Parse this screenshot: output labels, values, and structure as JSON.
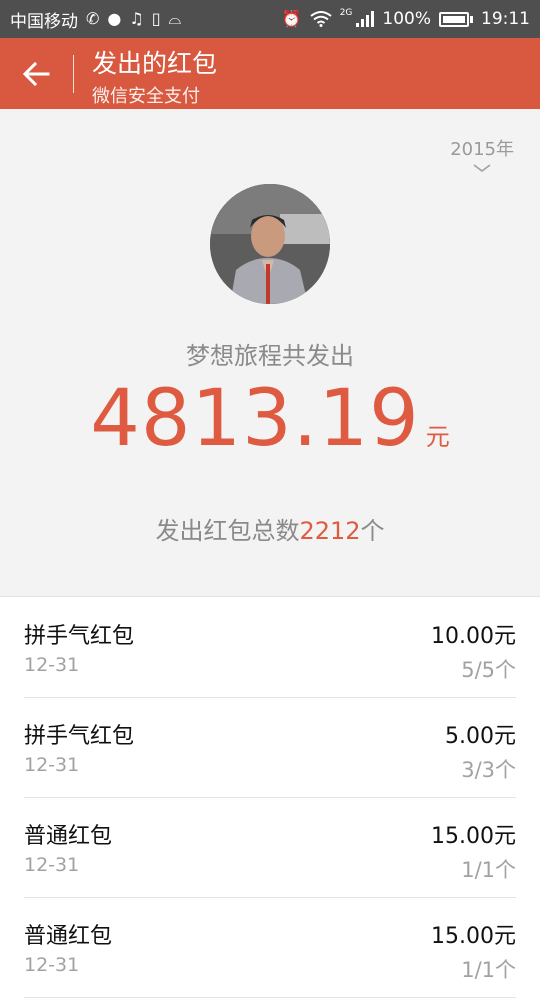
{
  "status_bar": {
    "carrier": "中国移动",
    "battery": "100%",
    "network": "2G",
    "time": "19:11"
  },
  "header": {
    "title": "发出的红包",
    "subtitle": "微信安全支付"
  },
  "summary": {
    "year": "2015年",
    "sender_line": "梦想旅程共发出",
    "amount": "4813.19",
    "amount_unit": "元",
    "count_prefix": "发出红包总数",
    "count": "2212",
    "count_suffix": "个"
  },
  "records": [
    {
      "name": "拼手气红包",
      "date": "12-31",
      "amount": "10.00元",
      "count": "5/5个"
    },
    {
      "name": "拼手气红包",
      "date": "12-31",
      "amount": "5.00元",
      "count": "3/3个"
    },
    {
      "name": "普通红包",
      "date": "12-31",
      "amount": "15.00元",
      "count": "1/1个"
    },
    {
      "name": "普通红包",
      "date": "12-31",
      "amount": "15.00元",
      "count": "1/1个"
    }
  ],
  "colors": {
    "status_bar_bg": "#4f4f4f",
    "title_bar_bg": "#d85940",
    "accent_red": "#de5b41",
    "summary_bg": "#f4f3f3"
  },
  "icons": [
    "wechat-icon",
    "photo-icon",
    "ting-icon",
    "sim-icon",
    "android-icon",
    "alarm-icon",
    "wifi-icon",
    "signal-icon",
    "battery-icon",
    "back-arrow-icon",
    "chevron-down-icon"
  ]
}
